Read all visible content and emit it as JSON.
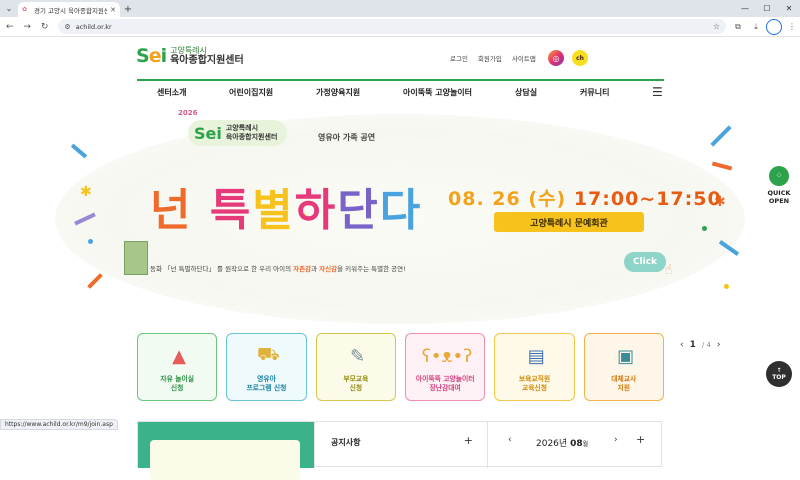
{
  "browser": {
    "tab_title": "경기 고양시 육아종합지원센터",
    "url": "achild.or.kr",
    "status_url": "https://www.achild.or.kr/m9/join.asp"
  },
  "header": {
    "logo_line1": "고양특례시",
    "logo_line2": "육아종합지원센터",
    "toplinks": [
      "로그인",
      "회원가입",
      "사이트맵"
    ],
    "sns": {
      "kakao": "ch"
    }
  },
  "gnb": [
    "센터소개",
    "어린이집지원",
    "가정양육지원",
    "아이뚝뚝 고양놀이터",
    "상담실",
    "커뮤니티"
  ],
  "banner": {
    "year": "2026",
    "logo_line1": "고양특례시",
    "logo_line2": "육아종합지원센터",
    "subtitle": "영유아 가족 공연",
    "title_chars": [
      "넌",
      " ",
      "특",
      "별",
      "하",
      "단",
      "다"
    ],
    "date": "08. 26 (수)",
    "time": "17:00~17:50",
    "place": "고양특례시 문예회관",
    "desc_prefix": "동화 「넌 특별하단다」 를 원작으로 한 우리 아이의 ",
    "desc_hl1": "자존감",
    "desc_mid": "과 ",
    "desc_hl2": "자신감",
    "desc_suffix": "을 키워주는 특별한 공연!",
    "click": "Click"
  },
  "quick_buttons": [
    {
      "line1": "자유 놀이실",
      "line2": "신청"
    },
    {
      "line1": "영유아",
      "line2": "프로그램 신청"
    },
    {
      "line1": "부모교육",
      "line2": "신청"
    },
    {
      "line1": "아이뚝뚝 고양놀이터",
      "line2": "장난감대여"
    },
    {
      "line1": "보육교직원",
      "line2": "교육신청"
    },
    {
      "line1": "대체교사",
      "line2": "지원"
    }
  ],
  "pager": {
    "current": "1",
    "total": "/ 4"
  },
  "quick_open": {
    "line1": "QUICK",
    "line2": "OPEN"
  },
  "top_button": "TOP",
  "notice": {
    "title": "공지사항",
    "plus": "+"
  },
  "calendar": {
    "year": "2026년",
    "month": "08",
    "month_unit": "월",
    "plus": "+"
  }
}
